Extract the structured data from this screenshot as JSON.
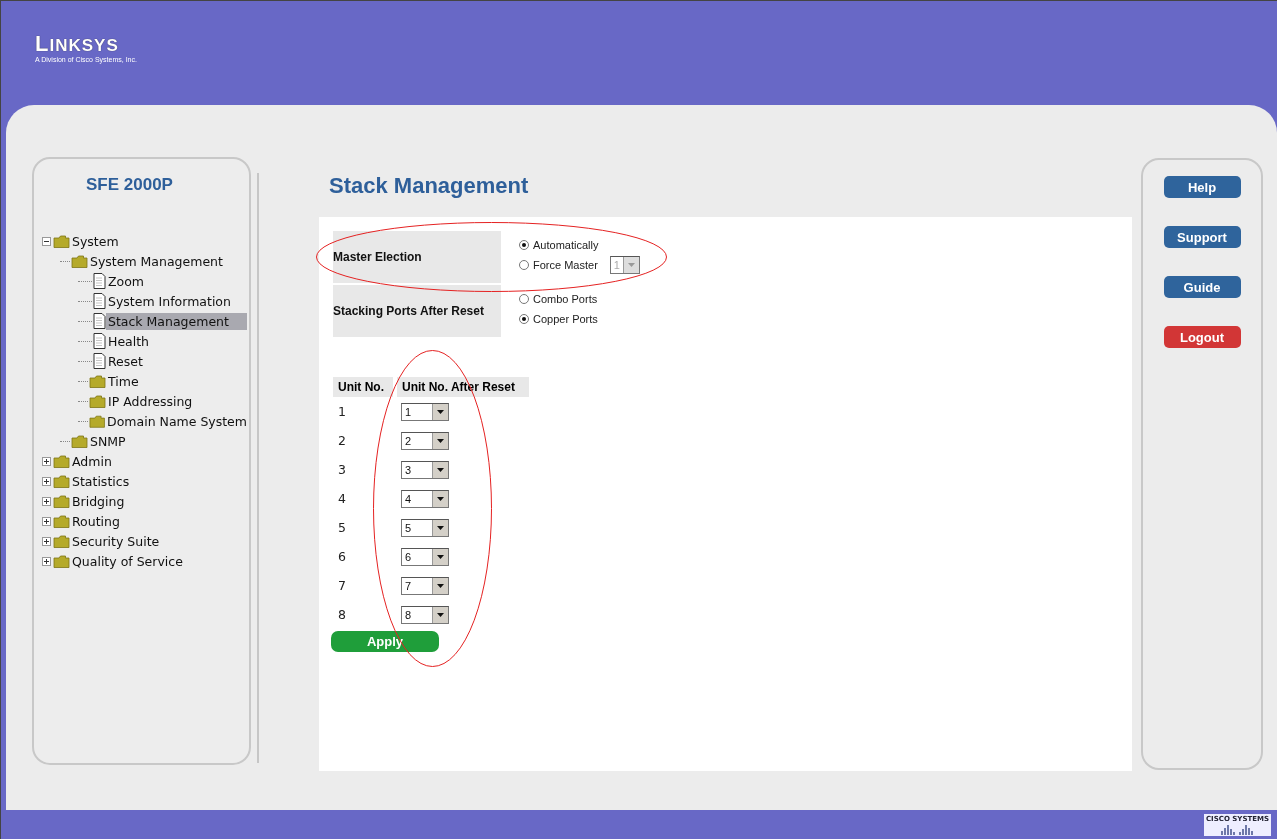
{
  "header": {
    "logo": "LINKSYS",
    "tagline": "A Division of Cisco Systems, Inc."
  },
  "sidebar": {
    "title": "SFE 2000P",
    "tree": [
      {
        "label": "System",
        "kind": "folder",
        "expanded": true,
        "selected": false,
        "children": [
          {
            "label": "System Management",
            "kind": "folder",
            "selected": false,
            "children": [
              {
                "label": "Zoom",
                "kind": "page",
                "selected": false
              },
              {
                "label": "System Information",
                "kind": "page",
                "selected": false
              },
              {
                "label": "Stack Management",
                "kind": "page",
                "selected": true
              },
              {
                "label": "Health",
                "kind": "page",
                "selected": false
              },
              {
                "label": "Reset",
                "kind": "page",
                "selected": false
              },
              {
                "label": "Time",
                "kind": "folder",
                "selected": false
              },
              {
                "label": "IP Addressing",
                "kind": "folder",
                "selected": false
              },
              {
                "label": "Domain Name System",
                "kind": "folder",
                "selected": false
              }
            ]
          },
          {
            "label": "SNMP",
            "kind": "folder",
            "selected": false
          }
        ]
      },
      {
        "label": "Admin",
        "kind": "folder",
        "expanded": false,
        "selected": false
      },
      {
        "label": "Statistics",
        "kind": "folder",
        "expanded": false,
        "selected": false
      },
      {
        "label": "Bridging",
        "kind": "folder",
        "expanded": false,
        "selected": false
      },
      {
        "label": "Routing",
        "kind": "folder",
        "expanded": false,
        "selected": false
      },
      {
        "label": "Security Suite",
        "kind": "folder",
        "expanded": false,
        "selected": false
      },
      {
        "label": "Quality of Service",
        "kind": "folder",
        "expanded": false,
        "selected": false
      }
    ]
  },
  "page_title": "Stack Management",
  "settings": [
    {
      "label": "Master Election",
      "options": [
        {
          "label": "Automatically",
          "selected": true
        },
        {
          "label": "Force Master",
          "selected": false,
          "select": {
            "value": "1",
            "disabled": true
          }
        }
      ]
    },
    {
      "label": "Stacking Ports After Reset",
      "options": [
        {
          "label": "Combo Ports",
          "selected": false
        },
        {
          "label": "Copper Ports",
          "selected": true
        }
      ]
    }
  ],
  "units_table": {
    "columns": [
      "Unit No.",
      "Unit No. After Reset"
    ],
    "rows": [
      {
        "unit": "1",
        "after_reset": "1"
      },
      {
        "unit": "2",
        "after_reset": "2"
      },
      {
        "unit": "3",
        "after_reset": "3"
      },
      {
        "unit": "4",
        "after_reset": "4"
      },
      {
        "unit": "5",
        "after_reset": "5"
      },
      {
        "unit": "6",
        "after_reset": "6"
      },
      {
        "unit": "7",
        "after_reset": "7"
      },
      {
        "unit": "8",
        "after_reset": "8"
      }
    ]
  },
  "apply_button": "Apply",
  "side_buttons": [
    {
      "label": "Help",
      "kind": "info"
    },
    {
      "label": "Support",
      "kind": "info"
    },
    {
      "label": "Guide",
      "kind": "info"
    },
    {
      "label": "Logout",
      "kind": "danger"
    }
  ],
  "footer": {
    "logo": "CISCO SYSTEMS"
  }
}
